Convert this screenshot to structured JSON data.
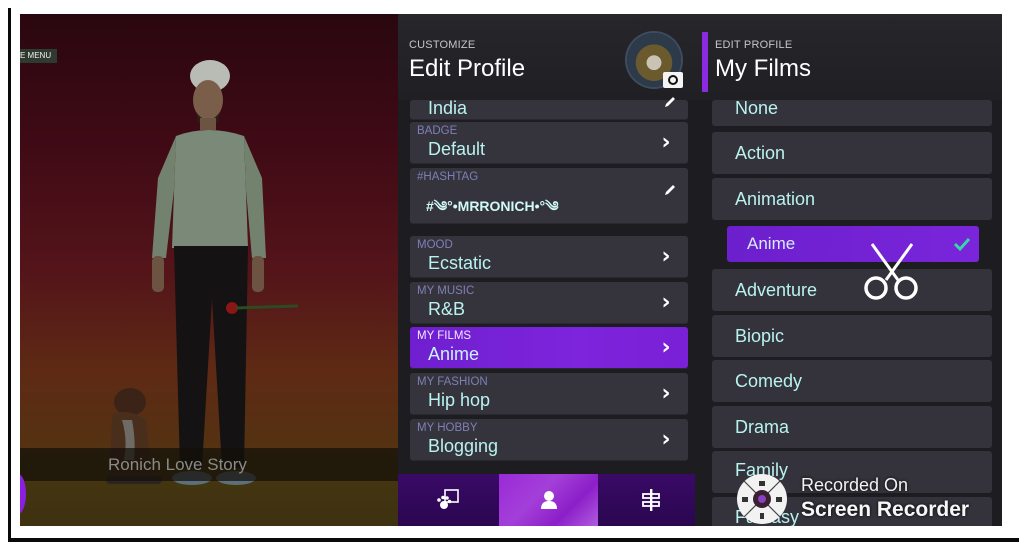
{
  "scene": {
    "menu_tag": "E MENU",
    "caption": "Ronich Love Story"
  },
  "edit_profile": {
    "eyebrow": "CUSTOMIZE",
    "title": "Edit Profile",
    "rows": [
      {
        "label": "",
        "value": "India",
        "action": "edit"
      },
      {
        "label": "BADGE",
        "value": "Default",
        "action": "chevron"
      },
      {
        "label": "#HASHTAG",
        "value": "#༄°•MRRONICH•°༄",
        "action": "edit"
      },
      {
        "label": "MOOD",
        "value": "Ecstatic",
        "action": "chevron"
      },
      {
        "label": "MY MUSIC",
        "value": "R&B",
        "action": "chevron"
      },
      {
        "label": "MY FILMS",
        "value": "Anime",
        "action": "chevron",
        "active": true
      },
      {
        "label": "MY FASHION",
        "value": "Hip hop",
        "action": "chevron"
      },
      {
        "label": "MY HOBBY",
        "value": "Blogging",
        "action": "chevron"
      }
    ],
    "chevron_glyph": "›",
    "tabs": [
      {
        "name": "pets-photo",
        "icon": "paw-photo-icon"
      },
      {
        "name": "profile",
        "icon": "person-icon",
        "active": true
      },
      {
        "name": "settings",
        "icon": "sliders-icon"
      }
    ]
  },
  "my_films": {
    "eyebrow": "EDIT PROFILE",
    "title": "My Films",
    "options": [
      {
        "value": "None"
      },
      {
        "value": "Action"
      },
      {
        "value": "Animation"
      },
      {
        "value": "Anime",
        "sub": true,
        "selected": true
      },
      {
        "value": "Adventure"
      },
      {
        "value": "Biopic"
      },
      {
        "value": "Comedy"
      },
      {
        "value": "Drama"
      },
      {
        "value": "Family"
      },
      {
        "value": "Fantasy"
      }
    ]
  },
  "watermark": {
    "line1": "Recorded On",
    "line2": "Screen Recorder"
  },
  "colors": {
    "accent_purple": "#7d24dc",
    "value_text": "#b8f3ee",
    "label_text": "#7f7fb6",
    "check_green": "#36d6a8"
  }
}
